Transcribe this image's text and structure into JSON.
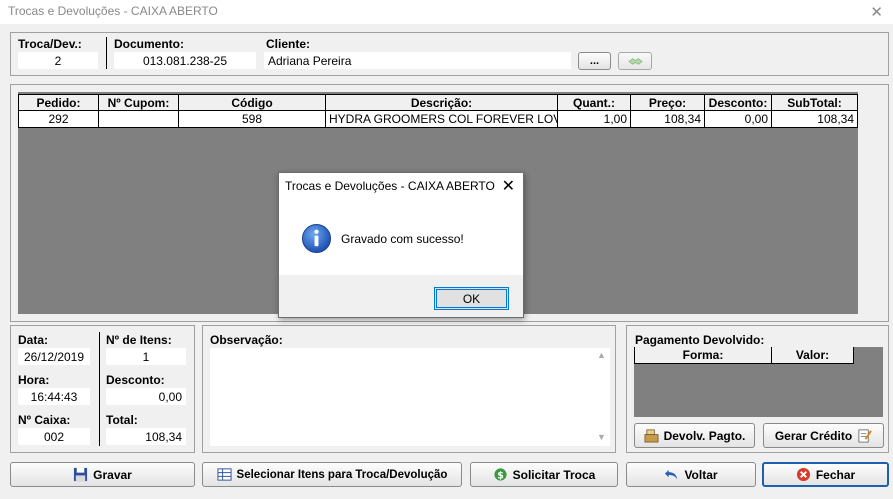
{
  "window": {
    "title": "Trocas e Devoluções - CAIXA ABERTO",
    "close_glyph": "✕"
  },
  "header": {
    "troca_label": "Troca/Dev.:",
    "troca_value": "2",
    "documento_label": "Documento:",
    "documento_value": "013.081.238-25",
    "cliente_label": "Cliente:",
    "cliente_value": "Adriana Pereira",
    "lookup_button": "..."
  },
  "grid": {
    "columns": [
      "Pedido:",
      "Nº Cupom:",
      "Código",
      "Descrição:",
      "Quant.:",
      "Preço:",
      "Desconto:",
      "SubTotal:"
    ],
    "rows": [
      [
        "292",
        "",
        "598",
        "HYDRA GROOMERS COL FOREVER LOVE ‹",
        "1,00",
        "108,34",
        "0,00",
        "108,34"
      ]
    ]
  },
  "summary": {
    "data_label": "Data:",
    "data_value": "26/12/2019",
    "hora_label": "Hora:",
    "hora_value": "16:44:43",
    "caixa_label": "Nº Caixa:",
    "caixa_value": "002",
    "itens_label": "Nº de Itens:",
    "itens_value": "1",
    "desconto_label": "Desconto:",
    "desconto_value": "0,00",
    "total_label": "Total:",
    "total_value": "108,34"
  },
  "observacao": {
    "label": "Observação:",
    "value": ""
  },
  "pagamento": {
    "title": "Pagamento Devolvido:",
    "columns": [
      "Forma:",
      "Valor:"
    ],
    "devolv_button": "Devolv. Pagto.",
    "credito_button": "Gerar Crédito"
  },
  "toolbar": {
    "gravar": "Gravar",
    "selecionar": "Selecionar Itens para Troca/Devolução",
    "solicitar": "Solicitar Troca",
    "voltar": "Voltar",
    "fechar": "Fechar"
  },
  "dialog": {
    "title": "Trocas e Devoluções - CAIXA ABERTO",
    "message": "Gravado com sucesso!",
    "ok": "OK",
    "close_glyph": "✕"
  },
  "colors": {
    "accent_blue": "#1e5fb0",
    "grid_bg": "#808080",
    "info_icon": "#1a5fc8"
  }
}
